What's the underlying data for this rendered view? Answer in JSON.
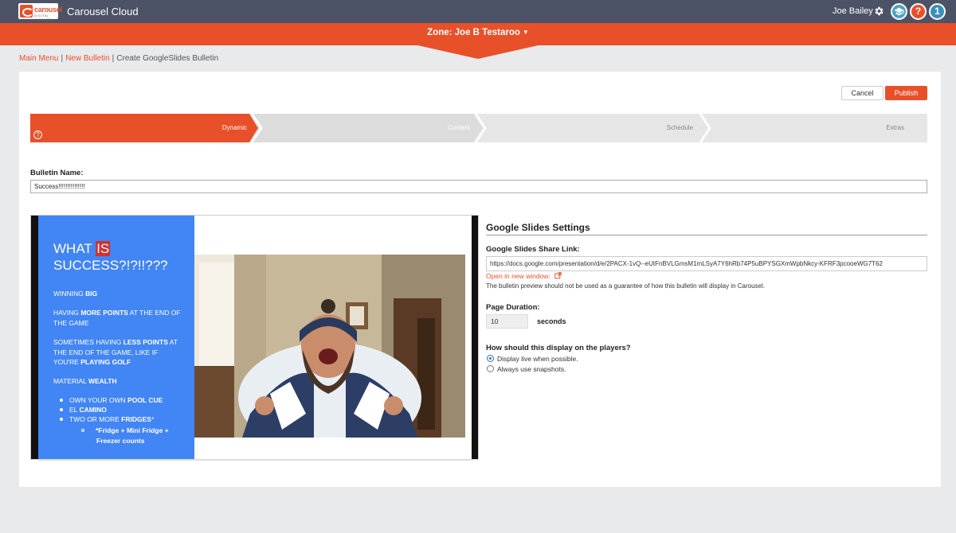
{
  "app": {
    "logo_word": "carousel",
    "logo_sub": "DIGITAL SIGNAGE",
    "title": "Carousel Cloud",
    "user_name": "Joe Bailey",
    "help_label": "",
    "question_label": "?",
    "notify_count": "1"
  },
  "zone": {
    "label": "Zone: Joe B Testaroo"
  },
  "breadcrumb": {
    "main_menu": "Main Menu",
    "new_bulletin": "New Bulletin",
    "current": "Create GoogleSlides Bulletin"
  },
  "actions": {
    "cancel": "Cancel",
    "publish": "Publish"
  },
  "steps": [
    {
      "label": "Dynamic",
      "active": true
    },
    {
      "label": "Content",
      "active": false
    },
    {
      "label": "Schedule",
      "active": false
    },
    {
      "label": "Extras",
      "active": false
    }
  ],
  "step_help": "?",
  "bulletin": {
    "name_label": "Bulletin Name:",
    "name_value": "Success!!!!!!!!!!!!!!!"
  },
  "slide": {
    "title_pre": "What ",
    "title_hl": "is",
    "title_post": "Success?!?!!???",
    "p1_a": "Winning ",
    "p1_b": "big",
    "p2_a": "Having ",
    "p2_b": "more points",
    "p2_c": " at the end of the game",
    "p3_a": "Sometimes having ",
    "p3_b": "less points",
    "p3_c": " at the end of the game, like if you're ",
    "p3_d": "playing golf",
    "p4_a": "Material ",
    "p4_b": "wealth",
    "b1_a": "Own your own ",
    "b1_b": "pool cue",
    "b2_a": "El ",
    "b2_b": "Camino",
    "b3_a": "Two or more ",
    "b3_b": "fridges",
    "b3_c": "*",
    "sub1": "*Fridge + Mini Fridge +",
    "sub2": "Freezer counts"
  },
  "settings": {
    "title": "Google Slides Settings",
    "link_label": "Google Slides Share Link:",
    "link_value": "https://docs.google.com/presentation/d/e/2PACX-1vQ--eUtFnBVLGmsM1mLSyA7Y6hRb74P5uBPYSGXmWpbNkcy-KFRF3pcooeWG7T62",
    "open_window": "Open in new window:",
    "disclaimer": "The bulletin preview should not be used as a guarantee of how this bulletin will display in Carousel.",
    "duration_label": "Page Duration:",
    "duration_value": "10",
    "duration_unit": "seconds",
    "display_label": "How should this display on the players?",
    "option_live": "Display live when possible.",
    "option_snapshot": "Always use snapshots.",
    "selected": "live"
  },
  "colors": {
    "brand": "#e8502a",
    "topbar": "#4d5366",
    "slide_blue": "#4285f4"
  }
}
